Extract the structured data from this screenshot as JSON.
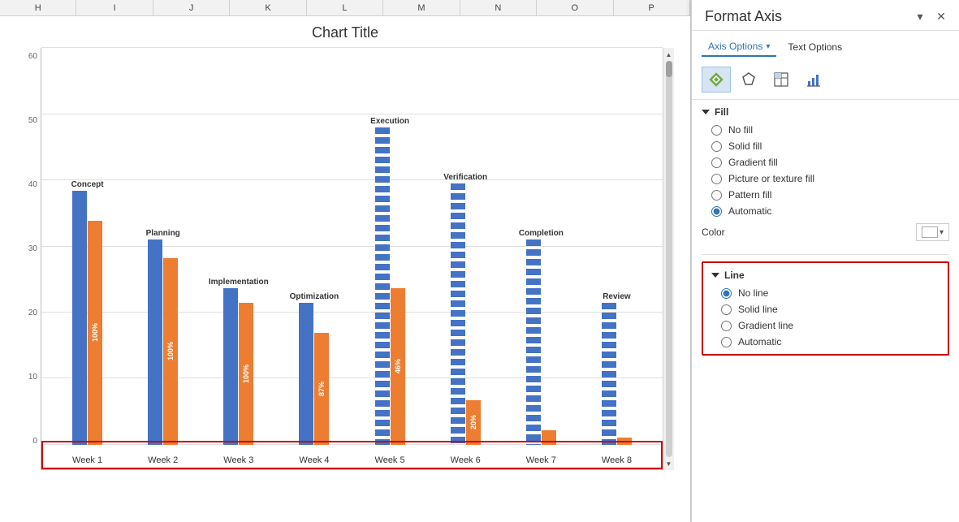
{
  "spreadsheet": {
    "col_headers": [
      "H",
      "I",
      "J",
      "K",
      "L",
      "M",
      "N",
      "O",
      "P"
    ]
  },
  "chart": {
    "title": "Chart Title",
    "y_axis_labels": [
      "60",
      "50",
      "40",
      "30",
      "20",
      "10",
      "0"
    ],
    "bar_groups": [
      {
        "id": "week1",
        "x_label": "Week 1",
        "category": "Concept",
        "blue_height_pct": 68,
        "orange_height_pct": 60,
        "pct_label": "100%",
        "dashed": false
      },
      {
        "id": "week2",
        "x_label": "Week 2",
        "category": "Planning",
        "blue_height_pct": 55,
        "orange_height_pct": 50,
        "pct_label": "100%",
        "dashed": false
      },
      {
        "id": "week3",
        "x_label": "Week 3",
        "category": "Implementation",
        "blue_height_pct": 42,
        "orange_height_pct": 38,
        "pct_label": "100%",
        "dashed": false
      },
      {
        "id": "week4",
        "x_label": "Week 4",
        "category": "Optimization",
        "blue_height_pct": 38,
        "orange_height_pct": 30,
        "pct_label": "87%",
        "dashed": false
      },
      {
        "id": "week5",
        "x_label": "Week 5",
        "category": "Execution",
        "blue_height_pct": 85,
        "orange_height_pct": 42,
        "pct_label": "46%",
        "dashed": true
      },
      {
        "id": "week6",
        "x_label": "Week 6",
        "category": "Verification",
        "blue_height_pct": 70,
        "orange_height_pct": 12,
        "pct_label": "20%",
        "dashed": true
      },
      {
        "id": "week7",
        "x_label": "Week 7",
        "category": "Completion",
        "blue_height_pct": 55,
        "orange_height_pct": 4,
        "pct_label": "",
        "dashed": true
      },
      {
        "id": "week8",
        "x_label": "Week 8",
        "category": "Review",
        "blue_height_pct": 38,
        "orange_height_pct": 2,
        "pct_label": "",
        "dashed": true
      }
    ]
  },
  "format_panel": {
    "title": "Format Axis",
    "tab_axis_options": "Axis Options",
    "tab_text_options": "Text Options",
    "icon_tabs": [
      "fill-effects-icon",
      "shape-icon",
      "layout-icon",
      "chart-icon"
    ],
    "fill_section": {
      "title": "Fill",
      "options": [
        {
          "id": "no-fill",
          "label": "No fill",
          "checked": false
        },
        {
          "id": "solid-fill",
          "label": "Solid fill",
          "checked": false
        },
        {
          "id": "gradient-fill",
          "label": "Gradient fill",
          "checked": false
        },
        {
          "id": "picture-fill",
          "label": "Picture or texture fill",
          "checked": false
        },
        {
          "id": "pattern-fill",
          "label": "Pattern fill",
          "checked": false
        },
        {
          "id": "automatic",
          "label": "Automatic",
          "checked": true
        }
      ],
      "color_label": "Color"
    },
    "line_section": {
      "title": "Line",
      "options": [
        {
          "id": "no-line",
          "label": "No line",
          "checked": true
        },
        {
          "id": "solid-line",
          "label": "Solid line",
          "checked": false
        },
        {
          "id": "gradient-line",
          "label": "Gradient line",
          "checked": false
        },
        {
          "id": "automatic-line",
          "label": "Automatic",
          "checked": false
        }
      ]
    }
  }
}
